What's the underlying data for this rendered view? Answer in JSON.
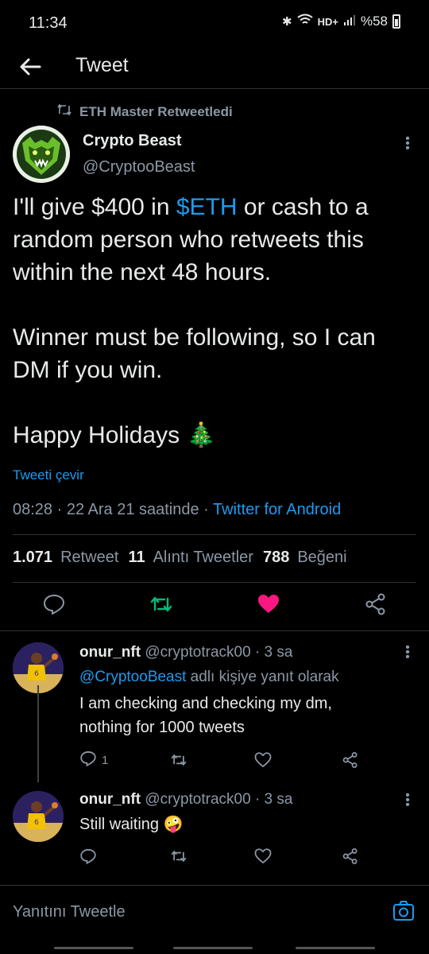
{
  "status_bar": {
    "time": "11:34",
    "network": "HD+",
    "battery": "%58"
  },
  "header": {
    "title": "Tweet"
  },
  "tweet": {
    "retweet_context": "ETH Master Retweetledi",
    "author_name": "Crypto Beast",
    "author_handle": "@CryptooBeast",
    "text_line1_pre": "I'll give $400 in ",
    "cashtag": "$ETH",
    "text_line1_post": " or cash to a random person who retweets this within the next 48 hours.",
    "text_para2": "Winner must be following, so I can DM if you win.",
    "text_para3": "Happy Holidays 🎄",
    "translate_label": "Tweeti çevir",
    "timestamp": "08:28 · 22 Ara 21 saatinde · ",
    "source": "Twitter for Android",
    "retweets_count": "1.071",
    "retweets_label": "Retweet",
    "quotes_count": "11",
    "quotes_label": "Alıntı Tweetler",
    "likes_count": "788",
    "likes_label": "Beğeni"
  },
  "replies": [
    {
      "author_name": "onur_nft",
      "author_handle": "@cryptotrack00",
      "time": "· 3 sa",
      "reply_to_mention": "@CryptooBeast",
      "reply_to_suffix": " adlı kişiye yanıt olarak",
      "text_line1": "I am checking and checking my dm,",
      "text_line2": "nothing for 1000 tweets",
      "reply_count": "1"
    },
    {
      "author_name": "onur_nft",
      "author_handle": "@cryptotrack00",
      "time": "· 3 sa",
      "text_line1": "Still waiting 🤪"
    }
  ],
  "compose": {
    "placeholder": "Yanıtını Tweetle"
  },
  "colors": {
    "accent": "#1d9bf0",
    "retweet_green": "#00ba7c",
    "like_pink": "#f91880",
    "muted": "#8b98a5"
  },
  "icons": [
    "back-arrow-icon",
    "retweet-icon",
    "more-icon",
    "reply-icon",
    "heart-icon",
    "share-icon",
    "camera-icon"
  ]
}
